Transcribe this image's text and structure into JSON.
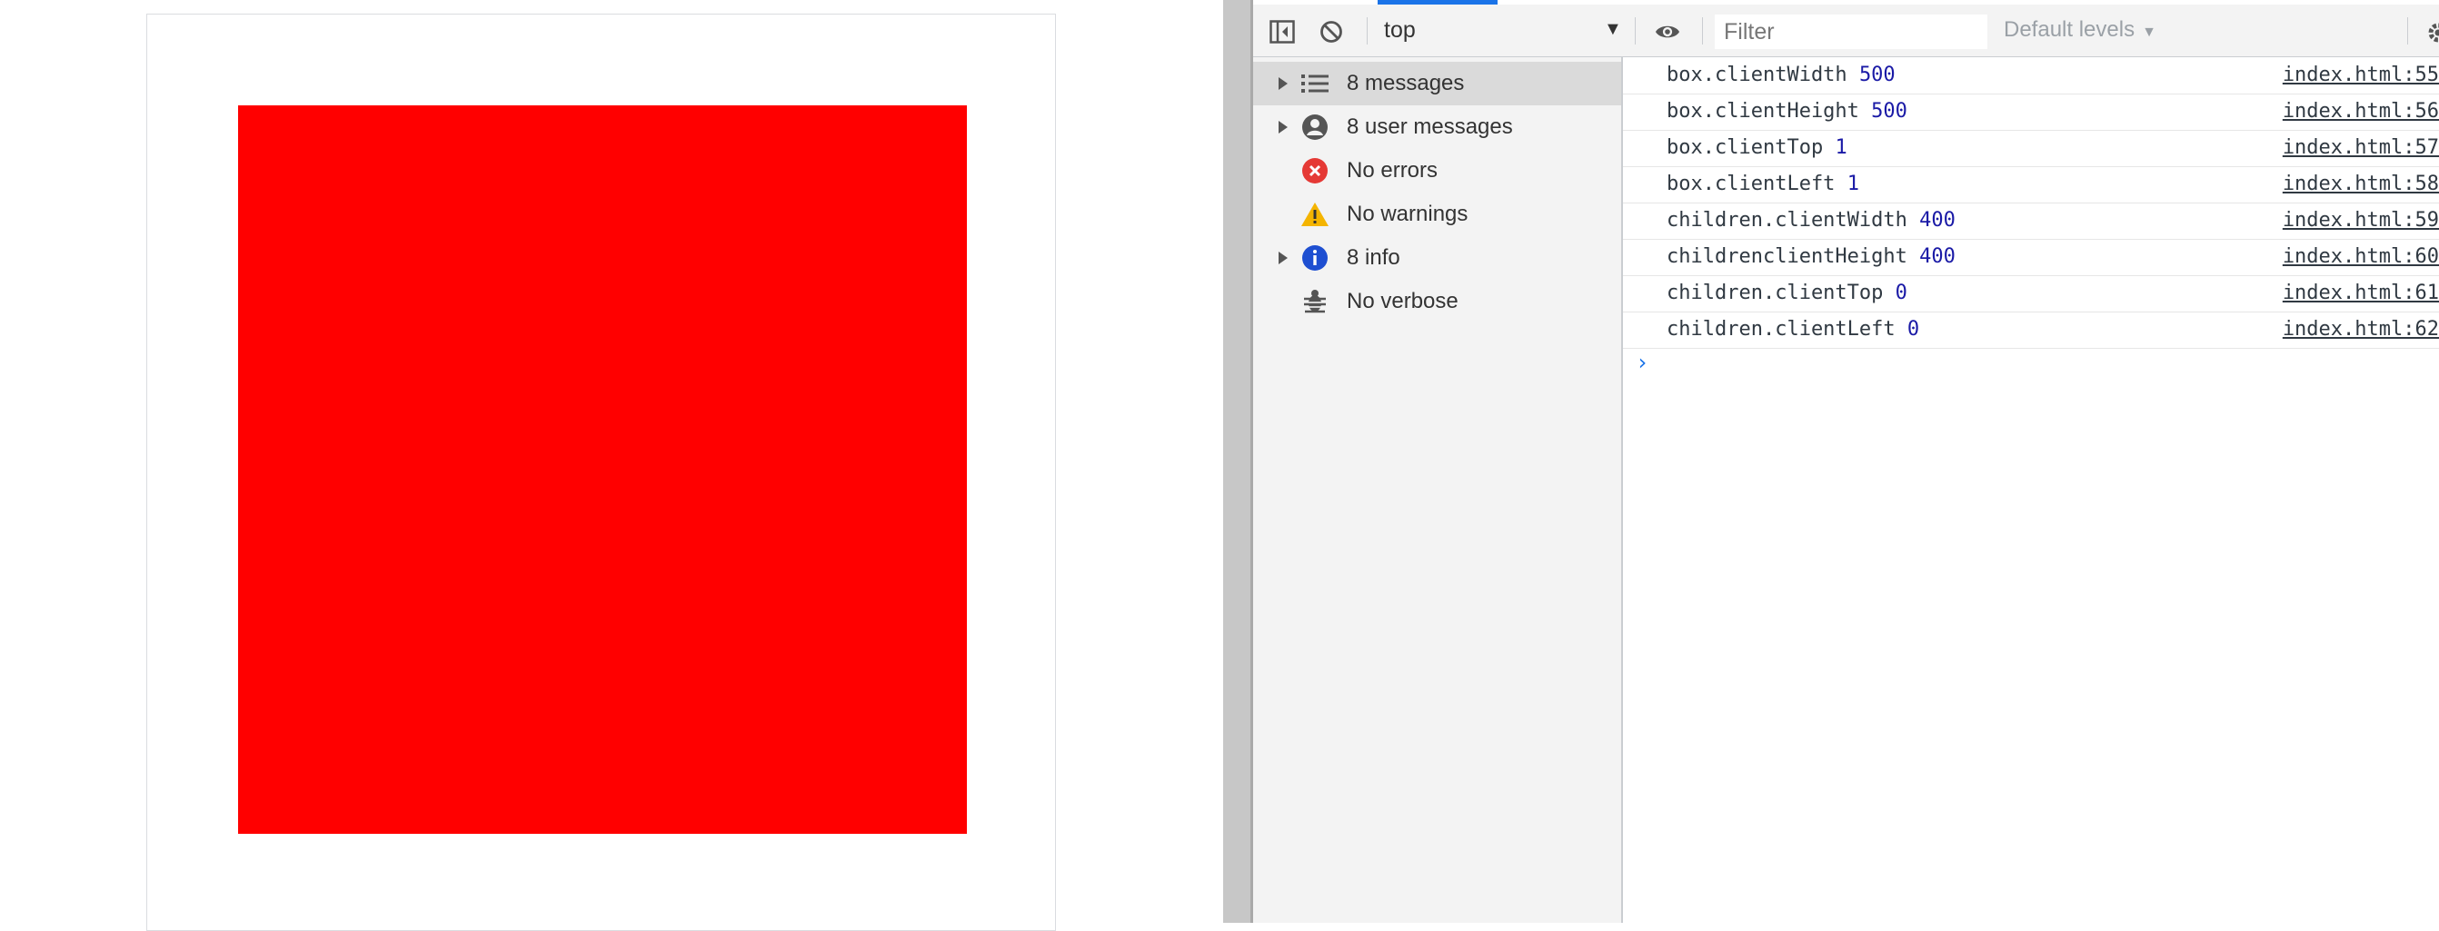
{
  "toolbar": {
    "context": "top",
    "filter_placeholder": "Filter",
    "levels_label": "Default levels"
  },
  "sidebar": {
    "items": [
      {
        "label": "8 messages",
        "icon": "list-icon",
        "expandable": true,
        "selected": true
      },
      {
        "label": "8 user messages",
        "icon": "user-icon",
        "expandable": true,
        "selected": false
      },
      {
        "label": "No errors",
        "icon": "error-icon",
        "expandable": false,
        "selected": false
      },
      {
        "label": "No warnings",
        "icon": "warning-icon",
        "expandable": false,
        "selected": false
      },
      {
        "label": "8 info",
        "icon": "info-icon",
        "expandable": true,
        "selected": false
      },
      {
        "label": "No verbose",
        "icon": "bug-icon",
        "expandable": false,
        "selected": false
      }
    ]
  },
  "console": {
    "messages": [
      {
        "text": "box.clientWidth",
        "value": "500",
        "source": "index.html:55"
      },
      {
        "text": "box.clientHeight",
        "value": "500",
        "source": "index.html:56"
      },
      {
        "text": "box.clientTop",
        "value": "1",
        "source": "index.html:57"
      },
      {
        "text": "box.clientLeft",
        "value": "1",
        "source": "index.html:58"
      },
      {
        "text": "children.clientWidth",
        "value": "400",
        "source": "index.html:59"
      },
      {
        "text": "childrenclientHeight",
        "value": "400",
        "source": "index.html:60"
      },
      {
        "text": "children.clientTop",
        "value": "0",
        "source": "index.html:61"
      },
      {
        "text": "children.clientLeft",
        "value": "0",
        "source": "index.html:62"
      }
    ],
    "prompt": "›"
  },
  "colors": {
    "box_fill": "#ff0000",
    "accent": "#1a73e8",
    "number": "#1a1aa6"
  }
}
